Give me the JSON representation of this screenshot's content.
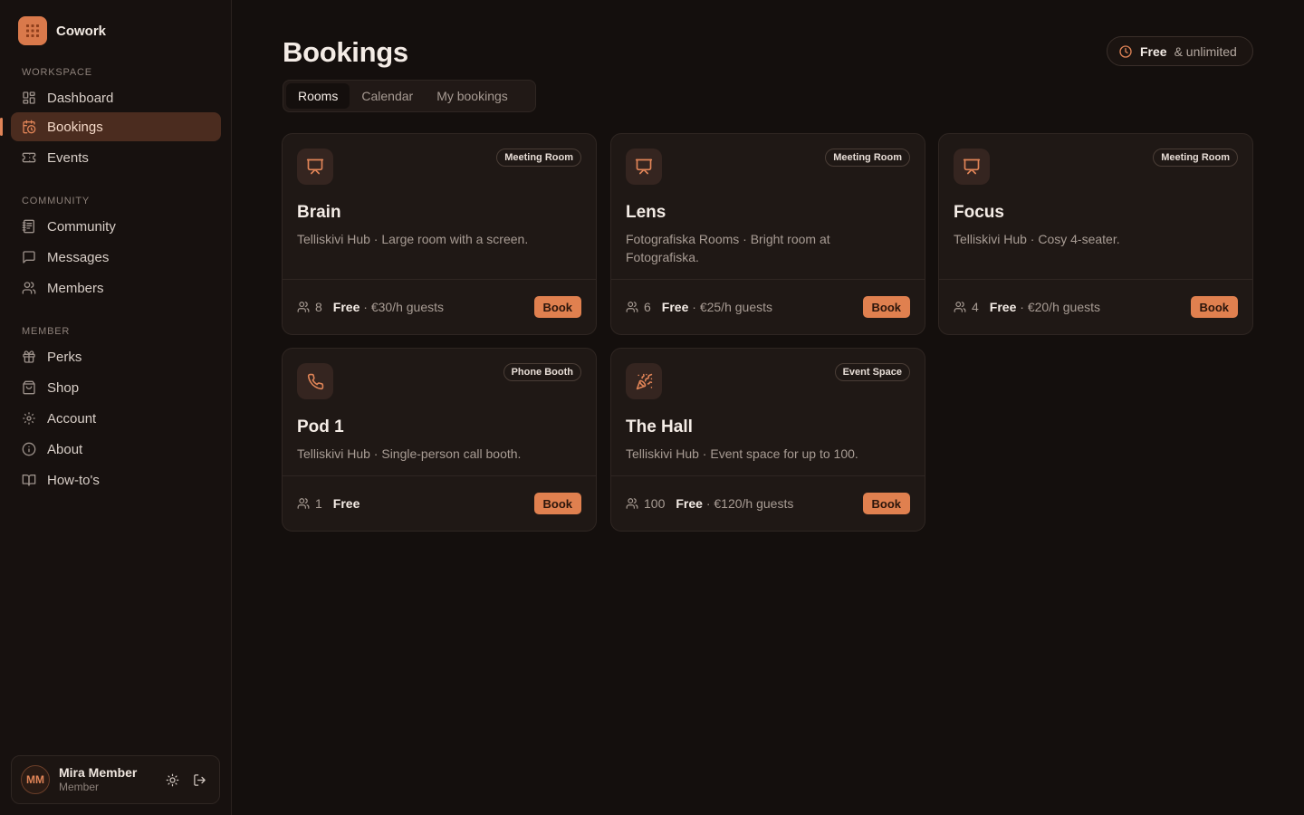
{
  "app": {
    "name": "Cowork"
  },
  "sidebar": {
    "sections": [
      {
        "label": "WORKSPACE",
        "items": [
          "Dashboard",
          "Bookings",
          "Events"
        ]
      },
      {
        "label": "COMMUNITY",
        "items": [
          "Community",
          "Messages",
          "Members"
        ]
      },
      {
        "label": "MEMBER",
        "items": [
          "Perks",
          "Shop",
          "Account",
          "About",
          "How-to's"
        ]
      }
    ],
    "active_item": "Bookings",
    "user": {
      "initials": "MM",
      "name": "Mira Member",
      "role": "Member"
    }
  },
  "header": {
    "title": "Bookings",
    "plan": {
      "label": "Free",
      "detail": "& unlimited"
    }
  },
  "tabs": [
    "Rooms",
    "Calendar",
    "My bookings"
  ],
  "active_tab": "Rooms",
  "rooms": [
    {
      "name": "Brain",
      "type": "Meeting Room",
      "icon": "presentation-icon",
      "description": "Telliskivi Hub · Large room with a screen.",
      "capacity": "8",
      "price_free": "Free",
      "price_guest": "· €30/h guests",
      "book_label": "Book"
    },
    {
      "name": "Lens",
      "type": "Meeting Room",
      "icon": "presentation-icon",
      "description": "Fotografiska Rooms · Bright room at Fotografiska.",
      "capacity": "6",
      "price_free": "Free",
      "price_guest": "· €25/h guests",
      "book_label": "Book"
    },
    {
      "name": "Focus",
      "type": "Meeting Room",
      "icon": "presentation-icon",
      "description": "Telliskivi Hub · Cosy 4-seater.",
      "capacity": "4",
      "price_free": "Free",
      "price_guest": "· €20/h guests",
      "book_label": "Book"
    },
    {
      "name": "Pod 1",
      "type": "Phone Booth",
      "icon": "phone-icon",
      "description": "Telliskivi Hub · Single-person call booth.",
      "capacity": "1",
      "price_free": "Free",
      "price_guest": "",
      "book_label": "Book"
    },
    {
      "name": "The Hall",
      "type": "Event Space",
      "icon": "party-popper-icon",
      "description": "Telliskivi Hub · Event space for up to 100.",
      "capacity": "100",
      "price_free": "Free",
      "price_guest": "· €120/h guests",
      "book_label": "Book"
    }
  ],
  "colors": {
    "accent": "#e0804f",
    "background": "#140f0d",
    "card": "#1f1815",
    "active_nav": "#4b2c1f"
  }
}
